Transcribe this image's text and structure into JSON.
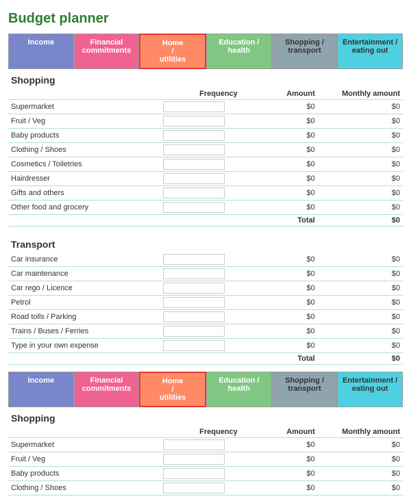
{
  "title": "Budget planner",
  "nav": {
    "tabs": [
      {
        "label": "Income",
        "class": "tab-income"
      },
      {
        "label": "Financial commitments",
        "class": "tab-financial"
      },
      {
        "label": "Home / utilities",
        "class": "tab-home",
        "active": true
      },
      {
        "label": "Education / health",
        "class": "tab-education"
      },
      {
        "label": "Shopping / transport",
        "class": "tab-shopping"
      },
      {
        "label": "Entertainment / eating out",
        "class": "tab-entertainment"
      }
    ]
  },
  "sections": [
    {
      "title": "Shopping",
      "headers": {
        "freq": "Frequency",
        "amount": "Amount",
        "monthly": "Monthly amount"
      },
      "rows": [
        {
          "label": "Supermarket",
          "amount": "$0",
          "monthly": "$0"
        },
        {
          "label": "Fruit / Veg",
          "amount": "$0",
          "monthly": "$0"
        },
        {
          "label": "Baby products",
          "amount": "$0",
          "monthly": "$0"
        },
        {
          "label": "Clothing / Shoes",
          "amount": "$0",
          "monthly": "$0"
        },
        {
          "label": "Cosmetics / Toiletries",
          "amount": "$0",
          "monthly": "$0"
        },
        {
          "label": "Hairdresser",
          "amount": "$0",
          "monthly": "$0"
        },
        {
          "label": "Gifts and others",
          "amount": "$0",
          "monthly": "$0"
        },
        {
          "label": "Other food and grocery",
          "amount": "$0",
          "monthly": "$0"
        }
      ],
      "total": {
        "label": "Total",
        "monthly": "$0"
      }
    },
    {
      "title": "Transport",
      "headers": {
        "freq": "",
        "amount": "",
        "monthly": ""
      },
      "rows": [
        {
          "label": "Car insurance",
          "amount": "$0",
          "monthly": "$0"
        },
        {
          "label": "Car maintenance",
          "amount": "$0",
          "monthly": "$0"
        },
        {
          "label": "Car rego / Licence",
          "amount": "$0",
          "monthly": "$0"
        },
        {
          "label": "Petrol",
          "amount": "$0",
          "monthly": "$0"
        },
        {
          "label": "Road tolls / Parking",
          "amount": "$0",
          "monthly": "$0"
        },
        {
          "label": "Trains / Buses / Ferries",
          "amount": "$0",
          "monthly": "$0"
        },
        {
          "label": "Type in your own expense",
          "amount": "$0",
          "monthly": "$0"
        }
      ],
      "total": {
        "label": "Total",
        "monthly": "$0"
      }
    }
  ],
  "sections2": [
    {
      "title": "Shopping",
      "headers": {
        "freq": "Frequency",
        "amount": "Amount",
        "monthly": "Monthly amount"
      },
      "rows": [
        {
          "label": "Supermarket",
          "amount": "$0",
          "monthly": "$0"
        },
        {
          "label": "Fruit / Veg",
          "amount": "$0",
          "monthly": "$0"
        },
        {
          "label": "Baby products",
          "amount": "$0",
          "monthly": "$0"
        },
        {
          "label": "Clothing / Shoes",
          "amount": "$0",
          "monthly": "$0"
        }
      ]
    }
  ]
}
